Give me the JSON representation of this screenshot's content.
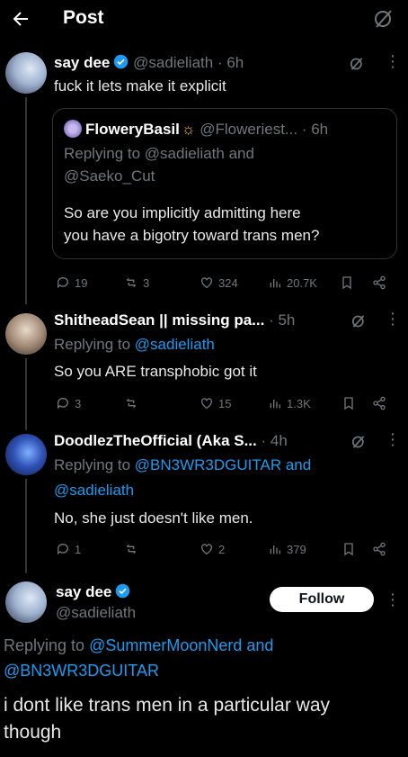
{
  "header": {
    "title": "Post"
  },
  "tweets": [
    {
      "name": "say dee",
      "handle": "@sadieliath",
      "time": "· 6h",
      "text": "fuck it lets make it explicit",
      "quote": {
        "name": "FloweryBasil",
        "handle": "@Floweriest...",
        "time": "· 6h",
        "reply_line1": "Replying to @sadieliath and",
        "reply_line2": "@Saeko_Cut",
        "text_line1": "So are you implicitly admitting here",
        "text_line2": "you have a bigotry toward trans men?"
      },
      "stats": {
        "replies": "19",
        "retweets": "3",
        "likes": "324",
        "views": "20.7K"
      }
    },
    {
      "name": "ShitheadSean || missing pa...",
      "time": "· 5h",
      "reply_prefix": "Replying to ",
      "reply_to": "@sadieliath",
      "text": "So you ARE transphobic got it",
      "stats": {
        "replies": "3",
        "retweets": "",
        "likes": "15",
        "views": "1.3K"
      }
    },
    {
      "name": "DoodlezTheOfficial (Aka S...",
      "time": "· 4h",
      "reply_prefix": "Replying to ",
      "reply_to1": "@BN3WR3DGUITAR",
      "reply_and": " and",
      "reply_to2": "@sadieliath",
      "text": "No, she just doesn't like men.",
      "stats": {
        "replies": "1",
        "retweets": "",
        "likes": "2",
        "views": "379"
      }
    },
    {
      "name": "say dee",
      "handle": "@sadieliath",
      "follow_label": "Follow",
      "reply_prefix": "Replying to ",
      "reply_to1": "@SummerMoonNerd",
      "reply_and": " and",
      "reply_to2": "@BN3WR3DGUITAR",
      "text_line1": "i dont like trans men in a particular way",
      "text_line2": "though"
    }
  ],
  "colors": {
    "bg": "#000000",
    "text": "#e7e9ea",
    "muted": "#71767b",
    "link": "#1d9bf0",
    "verified": "#1d9bf0"
  }
}
